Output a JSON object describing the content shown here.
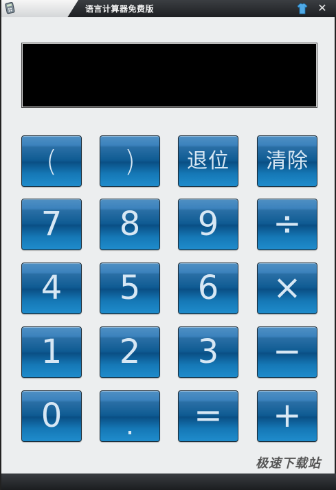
{
  "window": {
    "title": "语言计算器免费版",
    "close_glyph": "✕",
    "skin_icon": "shirt-icon"
  },
  "display": {
    "value": ""
  },
  "keys": {
    "lparen": "(",
    "rparen": ")",
    "backspace": "退位",
    "clear": "清除",
    "seven": "7",
    "eight": "8",
    "nine": "9",
    "divide": "÷",
    "four": "4",
    "five": "5",
    "six": "6",
    "multiply": "×",
    "one": "1",
    "two": "2",
    "three": "3",
    "minus": "−",
    "zero": "0",
    "dot": ".",
    "equals": "=",
    "plus": "+"
  },
  "watermark": "极速下载站",
  "colors": {
    "key_blue": "#1578b6",
    "key_text": "#d7e7f4",
    "display_bg": "#000000",
    "titlebar": "#1d1f22"
  }
}
